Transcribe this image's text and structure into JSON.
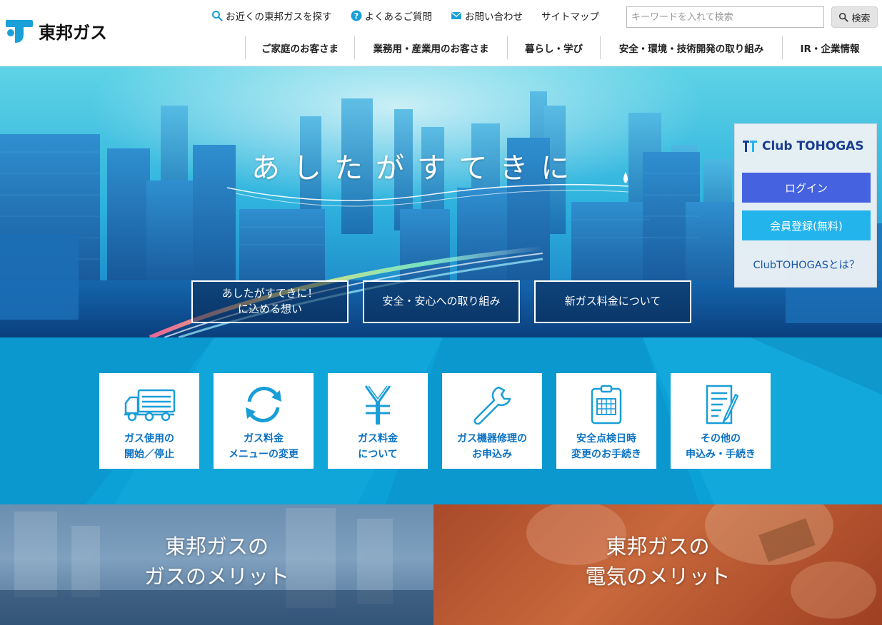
{
  "header": {
    "logo_text": "東邦ガス",
    "util_links": [
      {
        "label": "お近くの東邦ガスを探す",
        "icon": "search-icon"
      },
      {
        "label": "よくあるご質問",
        "icon": "question-icon"
      },
      {
        "label": "お問い合わせ",
        "icon": "mail-icon"
      },
      {
        "label": "サイトマップ",
        "icon": ""
      }
    ],
    "search_placeholder": "キーワードを入れて検索",
    "search_button": "検索",
    "main_nav": [
      "ご家庭のお客さま",
      "業務用・産業用のお客さま",
      "暮らし・学び",
      "安全・環境・技術開発の取り組み",
      "IR・企業情報"
    ],
    "brand_color": "#1aa0d8"
  },
  "hero": {
    "tagline": "あしたがすてきに",
    "buttons": [
      "あしたがすてきに！\nに込める想い",
      "安全・安心への取り組み",
      "新ガス料金について"
    ]
  },
  "club": {
    "logo_text": "Club TOHOGAS",
    "login": "ログイン",
    "register": "会員登録(無料)",
    "about": "ClubTOHOGASとは？",
    "login_color": "#4563e0",
    "register_color": "#24b4ec"
  },
  "services": [
    {
      "label": "ガス使用の\n開始／停止",
      "icon": "truck-icon"
    },
    {
      "label": "ガス料金\nメニューの変更",
      "icon": "refresh-icon"
    },
    {
      "label": "ガス料金\nについて",
      "icon": "yen-icon"
    },
    {
      "label": "ガス機器修理の\nお申込み",
      "icon": "wrench-icon"
    },
    {
      "label": "安全点検日時\n変更のお手続き",
      "icon": "calendar-icon"
    },
    {
      "label": "その他の\n申込み・手続き",
      "icon": "document-icon"
    }
  ],
  "panels": {
    "gas": "東邦ガスの\nガスのメリット",
    "electric": "東邦ガスの\n電気のメリット"
  }
}
